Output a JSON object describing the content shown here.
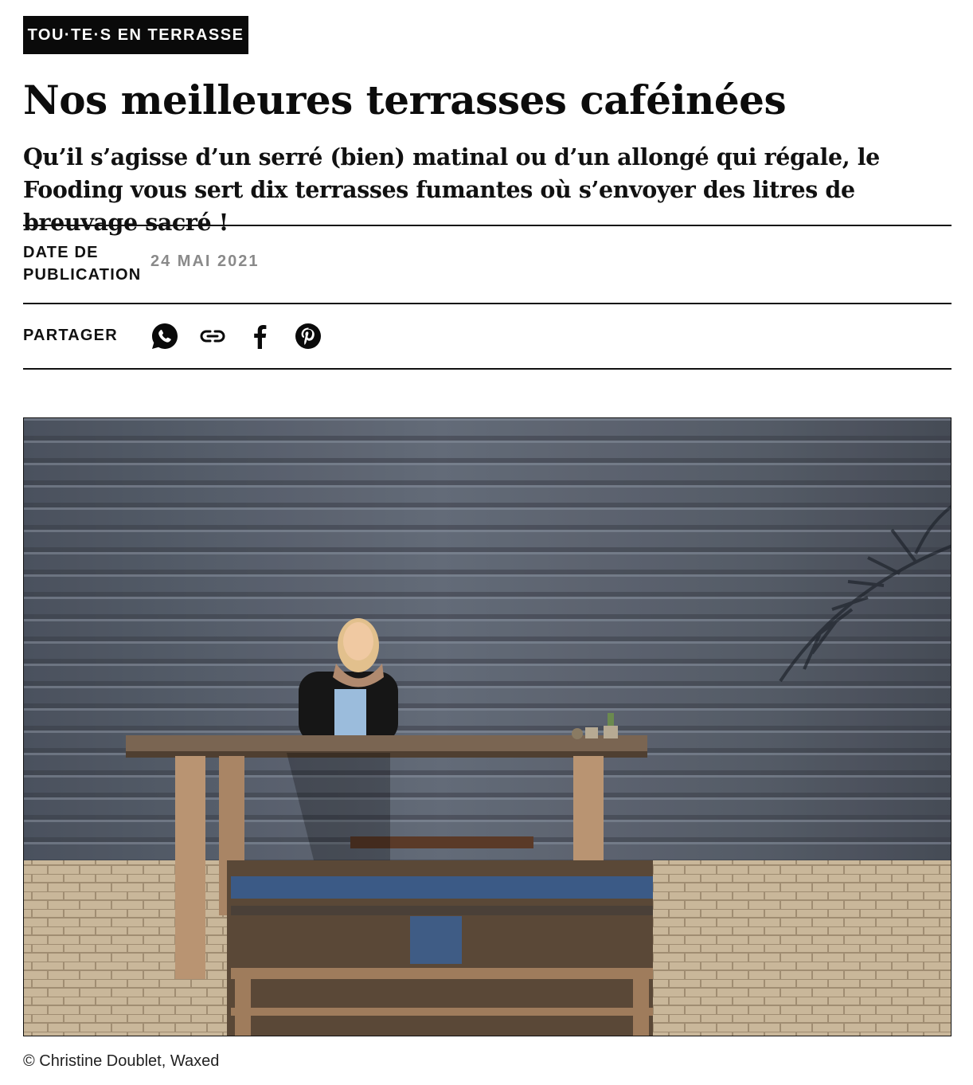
{
  "article": {
    "category_tag": "TOU·TE·S EN TERRASSE !",
    "title": "Nos meilleures terrasses caféinées",
    "lead": "Qu’il s’agisse d’un serré (bien) matinal ou d’un allongé qui régale, le Fooding vous sert dix terrasses fumantes où s’envoyer des litres de breuvage sacré !"
  },
  "meta": {
    "date_label": "DATE DE PUBLICATION",
    "date_value": "24 MAI 2021",
    "share_label": "PARTAGER",
    "share_icons": [
      "whatsapp-icon",
      "link-icon",
      "facebook-icon",
      "pinterest-icon"
    ]
  },
  "image": {
    "credit": "© Christine Doublet, Waxed"
  },
  "colors": {
    "tag_background": "#0a0a0a",
    "text": "#111111",
    "date_value": "#8a8a8a"
  }
}
